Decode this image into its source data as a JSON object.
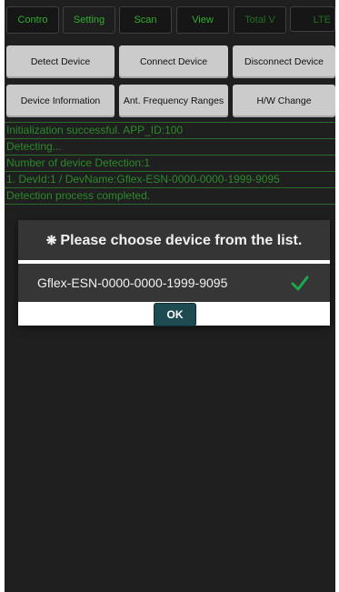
{
  "tabs": [
    {
      "label": "Contro"
    },
    {
      "label": "Setting"
    },
    {
      "label": "Scan"
    },
    {
      "label": "View"
    },
    {
      "label": "Total V"
    },
    {
      "label": "LTE"
    }
  ],
  "buttons": {
    "detect": "Detect Device",
    "connect": "Connect Device",
    "disconnect": "Disconnect Device",
    "device_info": "Device Information",
    "ant_freq": "Ant. Frequency Ranges",
    "hw_change": "H/W Change"
  },
  "log": [
    "Initialization successful.  APP_ID:100",
    "Detecting...",
    "Number of device Detection:1",
    "1. DevId:1 / DevName:Gflex-ESN-0000-0000-1999-9095",
    "Detection process completed."
  ],
  "dialog": {
    "marker": "❋",
    "title": "Please choose device from the list.",
    "item": "Gflex-ESN-0000-0000-1999-9095",
    "ok": "OK"
  },
  "colors": {
    "log_text": "#2b8a2b",
    "tab_text": "#2fae2f",
    "check": "#1aa84f",
    "ok_button": "#1e4a52"
  }
}
